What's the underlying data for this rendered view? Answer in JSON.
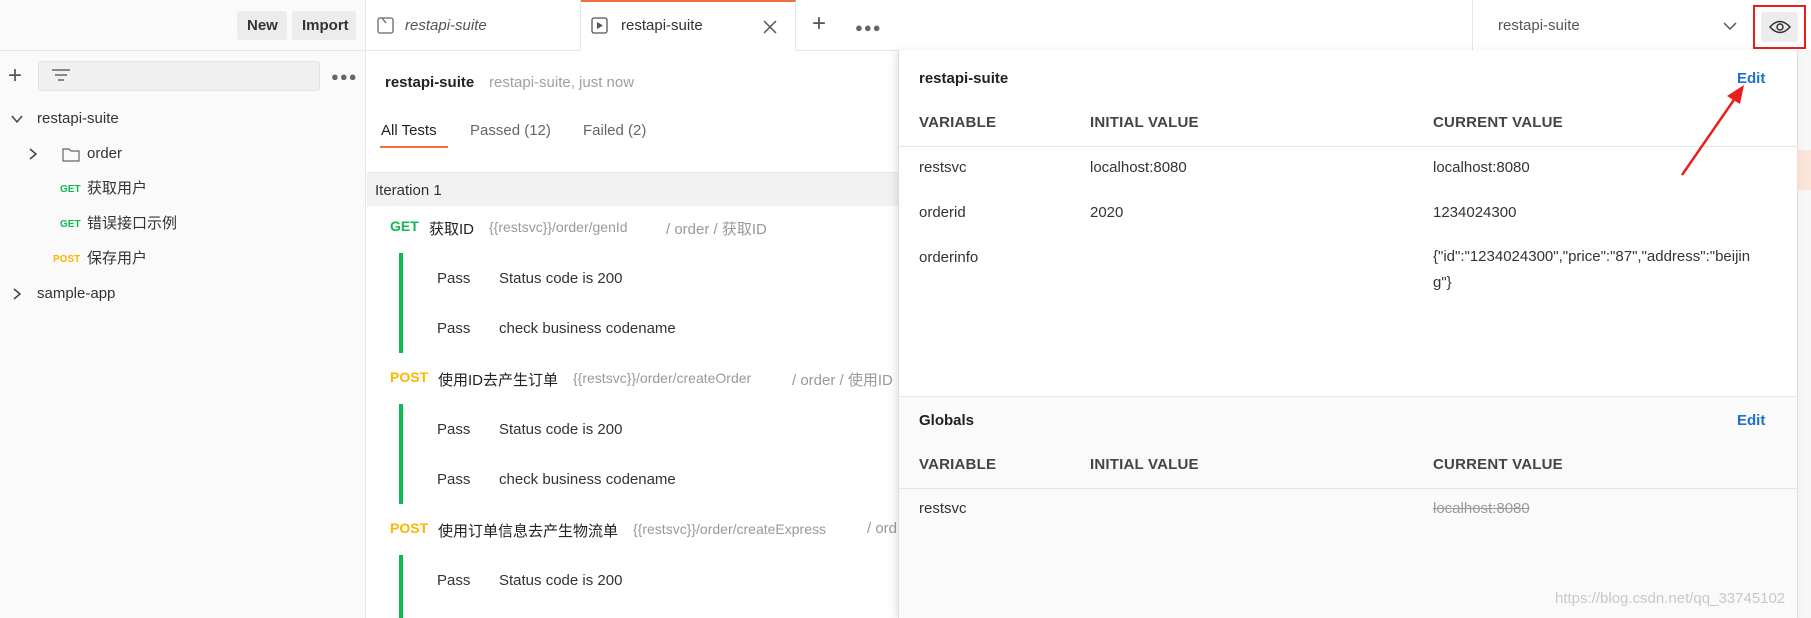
{
  "sidebar": {
    "new_label": "New",
    "import_label": "Import",
    "plus_icon": "plus-icon",
    "filter_icon": "filter-icon",
    "more_icon": "more-icon",
    "tree": [
      {
        "label": "restapi-suite",
        "kind": "collection",
        "expanded": true
      },
      {
        "label": "order",
        "kind": "folder",
        "expanded": false
      },
      {
        "method": "GET",
        "label": "获取用户",
        "kind": "request"
      },
      {
        "method": "GET",
        "label": "错误接口示例",
        "kind": "request"
      },
      {
        "method": "POST",
        "label": "保存用户",
        "kind": "request"
      },
      {
        "label": "sample-app",
        "kind": "collection",
        "expanded": false
      }
    ]
  },
  "tabs": {
    "items": [
      {
        "title": "restapi-suite",
        "icon": "collection-icon",
        "active": false
      },
      {
        "title": "restapi-suite",
        "icon": "runner-icon",
        "active": true
      }
    ],
    "close_icon": "close-icon",
    "add_icon": "plus-icon",
    "more_icon": "more-icon",
    "environment": "restapi-suite"
  },
  "runner": {
    "title": "restapi-suite",
    "subtitle": "restapi-suite, just now",
    "tabs": [
      "All Tests",
      "Passed (12)",
      "Failed (2)"
    ],
    "iteration": "Iteration 1",
    "requests": [
      {
        "method": "GET",
        "name": "获取ID",
        "url": "{{restsvc}}/order/genId",
        "path": "/ order / 获取ID",
        "tests": [
          {
            "status": "Pass",
            "name": "Status code is 200"
          },
          {
            "status": "Pass",
            "name": "check business codename"
          }
        ]
      },
      {
        "method": "POST",
        "name": "使用ID去产生订单",
        "url": "{{restsvc}}/order/createOrder",
        "path": "/ order / 使用ID",
        "tests": [
          {
            "status": "Pass",
            "name": "Status code is 200"
          },
          {
            "status": "Pass",
            "name": "check business codename"
          }
        ]
      },
      {
        "method": "POST",
        "name": "使用订单信息去产生物流单",
        "url": "{{restsvc}}/order/createExpress",
        "path": "/ ord",
        "tests": [
          {
            "status": "Pass",
            "name": "Status code is 200"
          }
        ]
      }
    ]
  },
  "env_panel": {
    "environment": {
      "title": "restapi-suite",
      "edit_label": "Edit",
      "headers": [
        "VARIABLE",
        "INITIAL VALUE",
        "CURRENT VALUE"
      ],
      "rows": [
        {
          "variable": "restsvc",
          "initial": "localhost:8080",
          "current": "localhost:8080"
        },
        {
          "variable": "orderid",
          "initial": "2020",
          "current": "1234024300"
        },
        {
          "variable": "orderinfo",
          "initial": "",
          "current": "{\"id\":\"1234024300\",\"price\":\"87\",\"address\":\"beijing\"}"
        }
      ]
    },
    "globals": {
      "title": "Globals",
      "edit_label": "Edit",
      "headers": [
        "VARIABLE",
        "INITIAL VALUE",
        "CURRENT VALUE"
      ],
      "rows": [
        {
          "variable": "restsvc",
          "initial": "",
          "current": "localhost:8080"
        }
      ]
    }
  },
  "watermark": "https://blog.csdn.net/qq_33745102",
  "colors": {
    "accent": "#f26b3a",
    "get": "#0cbb52",
    "post": "#ffb400",
    "link": "#1f6fcf",
    "pass_bar": "#0cbb52",
    "annotation": "#e8201b"
  }
}
